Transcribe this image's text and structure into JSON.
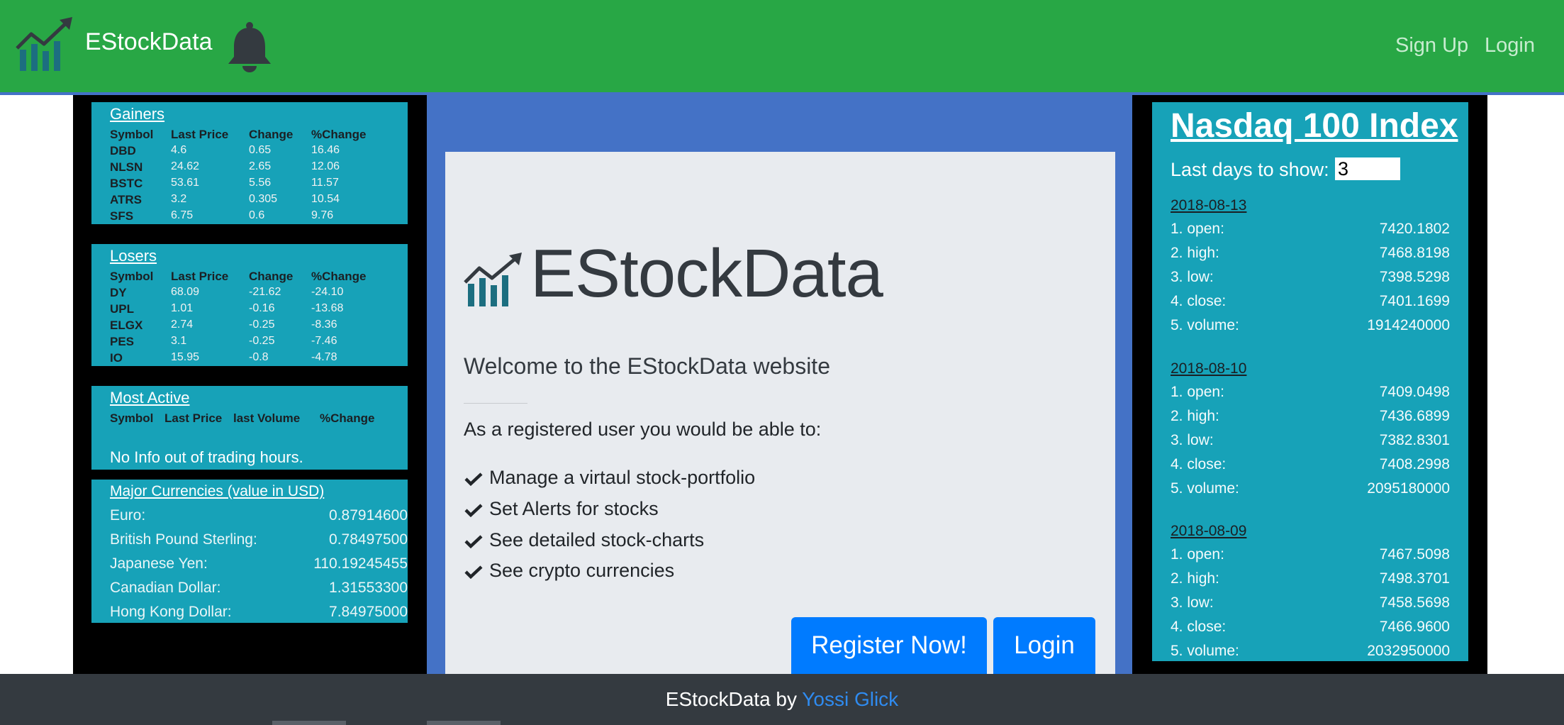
{
  "navbar": {
    "brand": "EStockData",
    "links": {
      "signup": "Sign Up",
      "login": "Login"
    },
    "bg_color": "#28a745"
  },
  "gainers": {
    "title": "Gainers",
    "headers": [
      "Symbol",
      "Last Price",
      "Change",
      "%Change"
    ],
    "rows": [
      [
        "DBD",
        "4.6",
        "0.65",
        "16.46"
      ],
      [
        "NLSN",
        "24.62",
        "2.65",
        "12.06"
      ],
      [
        "BSTC",
        "53.61",
        "5.56",
        "11.57"
      ],
      [
        "ATRS",
        "3.2",
        "0.305",
        "10.54"
      ],
      [
        "SFS",
        "6.75",
        "0.6",
        "9.76"
      ]
    ]
  },
  "losers": {
    "title": "Losers",
    "headers": [
      "Symbol",
      "Last Price",
      "Change",
      "%Change"
    ],
    "rows": [
      [
        "DY",
        "68.09",
        "-21.62",
        "-24.10"
      ],
      [
        "UPL",
        "1.01",
        "-0.16",
        "-13.68"
      ],
      [
        "ELGX",
        "2.74",
        "-0.25",
        "-8.36"
      ],
      [
        "PES",
        "3.1",
        "-0.25",
        "-7.46"
      ],
      [
        "IO",
        "15.95",
        "-0.8",
        "-4.78"
      ]
    ]
  },
  "most_active": {
    "title": "Most Active",
    "headers": [
      "Symbol",
      "Last Price",
      "last Volume",
      "%Change"
    ],
    "message": "No Info out of trading hours."
  },
  "currencies": {
    "title": "Major Currencies (value in USD)",
    "rows": [
      [
        "Euro:",
        "0.87914600"
      ],
      [
        "British Pound Sterling:",
        "0.78497500"
      ],
      [
        "Japanese Yen:",
        "110.19245455"
      ],
      [
        "Canadian Dollar:",
        "1.31553300"
      ],
      [
        "Hong Kong Dollar:",
        "7.84975000"
      ]
    ]
  },
  "card": {
    "brand": "EStockData",
    "welcome": "Welcome to the EStockData website",
    "lead": "As a registered user you would be able to:",
    "features": [
      "Manage a virtaul stock-portfolio",
      "Set Alerts for stocks",
      "See detailed stock-charts",
      "See crypto currencies"
    ],
    "register_label": "Register Now!",
    "login_label": "Login"
  },
  "nasdaq": {
    "title": "Nasdaq 100 Index",
    "days_label": "Last days to show:",
    "days_value": "3",
    "days": [
      {
        "date": "2018-08-13",
        "rows": [
          [
            "1. open:",
            "7420.1802"
          ],
          [
            "2. high:",
            "7468.8198"
          ],
          [
            "3. low:",
            "7398.5298"
          ],
          [
            "4. close:",
            "7401.1699"
          ],
          [
            "5. volume:",
            "1914240000"
          ]
        ]
      },
      {
        "date": "2018-08-10",
        "rows": [
          [
            "1. open:",
            "7409.0498"
          ],
          [
            "2. high:",
            "7436.6899"
          ],
          [
            "3. low:",
            "7382.8301"
          ],
          [
            "4. close:",
            "7408.2998"
          ],
          [
            "5. volume:",
            "2095180000"
          ]
        ]
      },
      {
        "date": "2018-08-09",
        "rows": [
          [
            "1. open:",
            "7467.5098"
          ],
          [
            "2. high:",
            "7498.3701"
          ],
          [
            "3. low:",
            "7458.5698"
          ],
          [
            "4. close:",
            "7466.9600"
          ],
          [
            "5. volume:",
            "2032950000"
          ]
        ]
      }
    ]
  },
  "footer": {
    "prefix": "EStockData by",
    "author": "Yossi Glick"
  }
}
